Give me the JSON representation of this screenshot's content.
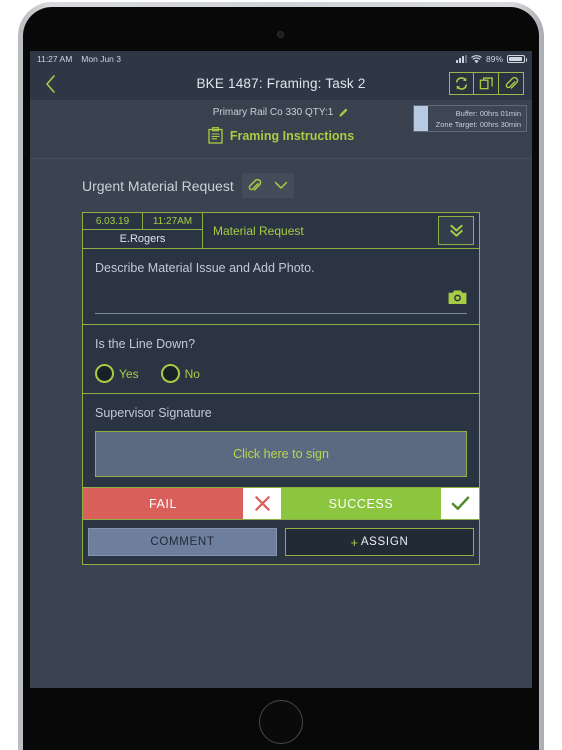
{
  "status_bar": {
    "time": "11:27 AM",
    "date": "Mon Jun 3",
    "battery_percent": "89%",
    "signal_icon": "signal-bars-icon",
    "wifi_icon": "wifi-icon",
    "battery_icon": "battery-icon"
  },
  "nav": {
    "back_icon": "chevron-left-icon",
    "title": "BKE 1487: Framing: Task 2",
    "actions": [
      {
        "name": "sync-icon",
        "label": "Sync"
      },
      {
        "name": "duplicate-icon",
        "label": "Duplicate"
      },
      {
        "name": "paperclip-icon",
        "label": "Attach"
      }
    ]
  },
  "subheader": {
    "primary_rail": "Primary Rail Co 330 QTY:1",
    "edit_icon": "pencil-icon",
    "instructions_icon": "clipboard-icon",
    "instructions_label": "Framing Instructions",
    "buffer_label": "Buffer:  00hrs 01min",
    "zone_target_label": "Zone Target: 00hrs 30min"
  },
  "urgent": {
    "label": "Urgent Material Request",
    "attach_icon": "paperclip-icon",
    "expand_icon": "chevron-down-icon"
  },
  "card": {
    "date": "6.03.19",
    "time": "11:27AM",
    "user": "E.Rogers",
    "title": "Material Request",
    "expand_icon": "double-chevron-down-icon",
    "describe": {
      "label": "Describe Material Issue and Add Photo.",
      "camera_icon": "camera-icon"
    },
    "line_down": {
      "question": "Is the Line Down?",
      "options": [
        "Yes",
        "No"
      ]
    },
    "signature": {
      "label": "Supervisor Signature",
      "placeholder": "Click here to sign"
    },
    "result_buttons": {
      "fail": "FAIL",
      "fail_icon": "x-icon",
      "success": "SUCCESS",
      "success_icon": "check-icon"
    },
    "action_buttons": {
      "comment": "COMMENT",
      "assign": "ASSIGN",
      "assign_plus": "+"
    }
  },
  "colors": {
    "accent_green": "#a8cc45",
    "fail_red": "#d9605a",
    "success_green": "#8cc63e",
    "page_bg": "#3c4350",
    "card_bg": "#2b3442",
    "header_bg": "#2e3745",
    "signature_bg": "#5b6a81"
  }
}
